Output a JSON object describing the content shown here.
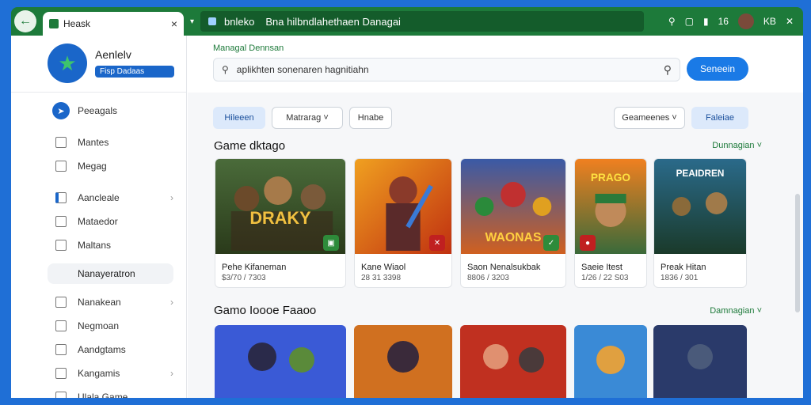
{
  "browser": {
    "tab_title": "Heask",
    "tab_close": "×",
    "tab_dropdown": "▾",
    "address_site": "bnleko",
    "address_path": "Bna hilbndlahethaen Danagai",
    "right_text": "KB",
    "status_text": "16"
  },
  "sidebar": {
    "profile_name": "Aenlelv",
    "profile_badge": "Fisp Dadaas",
    "items": [
      {
        "label": "Peeagals"
      },
      {
        "label": "Mantes"
      },
      {
        "label": "Megag"
      },
      {
        "label": "Aancleale"
      },
      {
        "label": "Mataedor"
      },
      {
        "label": "Maltans"
      }
    ],
    "section_label": "Nanayeratron",
    "items2": [
      {
        "label": "Nanakean"
      },
      {
        "label": "Negmoan"
      },
      {
        "label": "Aandgtams"
      },
      {
        "label": "Kangamis"
      },
      {
        "label": "Ulala Game"
      }
    ]
  },
  "main": {
    "crumb": "Managal Dennsan",
    "search_placeholder": "aplikhten sonenaren hagnitiahn",
    "search_button": "Seneein",
    "chips": [
      "Hileeen",
      "Matrarag",
      "Hnabe"
    ],
    "sort_dropdown": "Geameenes",
    "filter_button": "Faleiae",
    "section1_title": "Game dktago",
    "section1_link": "Dunnagian",
    "section2_title": "Gamo Ioooe Faaoo",
    "section2_link": "Damnagian",
    "cards": [
      {
        "name": "Pehe Kifaneman",
        "meta": "$3/70 / 7303",
        "art_text": "DRAKY"
      },
      {
        "name": "Kane Wiaol",
        "meta": "28 31 3398",
        "art_text": ""
      },
      {
        "name": "Saon Nenalsukbak",
        "meta": "8806 / 3203",
        "art_text": "WAONAS"
      },
      {
        "name": "Saeie Itest",
        "meta": "1/26 / 22 S03",
        "art_text": "PRAGO"
      },
      {
        "name": "Preak Hitan",
        "meta": "1836 / 301",
        "art_text": "PEAIDREN"
      }
    ]
  },
  "colors": {
    "accent": "#1a7ae6",
    "brand_green": "#1d7a3a"
  }
}
